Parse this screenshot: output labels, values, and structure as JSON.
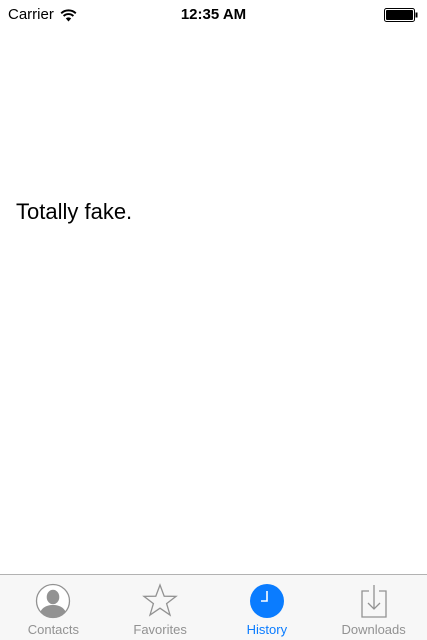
{
  "status_bar": {
    "carrier": "Carrier",
    "time": "12:35 AM",
    "wifi_icon": "wifi-icon",
    "battery_icon": "battery-full-icon"
  },
  "main": {
    "text": "Totally fake."
  },
  "tab_bar": {
    "active_color": "#0a7cff",
    "inactive_color": "#929292",
    "tabs": [
      {
        "label": "Contacts",
        "icon": "contacts-icon",
        "active": false
      },
      {
        "label": "Favorites",
        "icon": "star-icon",
        "active": false
      },
      {
        "label": "History",
        "icon": "clock-icon",
        "active": true
      },
      {
        "label": "Downloads",
        "icon": "download-icon",
        "active": false
      }
    ]
  }
}
